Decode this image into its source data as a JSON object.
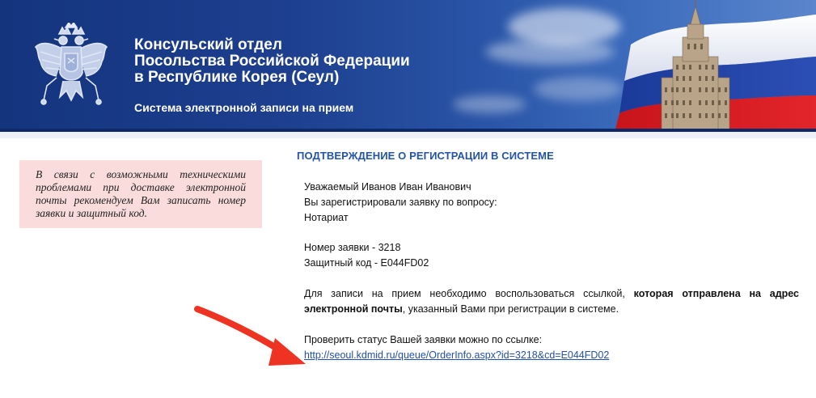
{
  "header": {
    "title_line1": "Консульский отдел",
    "title_line2": "Посольства Российской Федерации",
    "title_line3": "в Республике Корея (Сеул)",
    "subtitle": "Система электронной записи на прием",
    "emblem_icon": "russian-coat-of-arms-icon",
    "flag_image": "russian-flag-and-mfa-building"
  },
  "notice": {
    "text": "В связи с возможными техническими проблемами при доставке электронной почты рекомендуем Вам записать номер заявки и защитный код.",
    "background": "#fadcdc"
  },
  "confirmation": {
    "heading": "ПОДТВЕРЖДЕНИЕ О РЕГИСТРАЦИИ В СИСТЕМЕ",
    "greeting": "Уважаемый Иванов Иван Иванович",
    "registered_text": "Вы зарегистрировали заявку по вопросу:",
    "topic": "Нотариат",
    "order_number": "Номер заявки - 3218",
    "security_code": "Защитный код - E044FD02",
    "instruction_prefix": "Для записи на прием необходимо воспользоваться ссылкой, ",
    "instruction_bold": "которая отправлена на адрес электронной почты",
    "instruction_suffix": ", указанный Вами при регистрации в системе.",
    "status_text": "Проверить статус Вашей заявки можно по ссылке:",
    "status_link": "http://seoul.kdmid.ru/queue/OrderInfo.aspx?id=3218&cd=E044FD02"
  },
  "annotation": {
    "arrow_icon": "red-arrow-pointer-icon",
    "arrow_color": "#ee3322"
  },
  "colors": {
    "heading": "#2454a8",
    "link": "#2250a8",
    "header_bg": "#1d3f8e"
  }
}
